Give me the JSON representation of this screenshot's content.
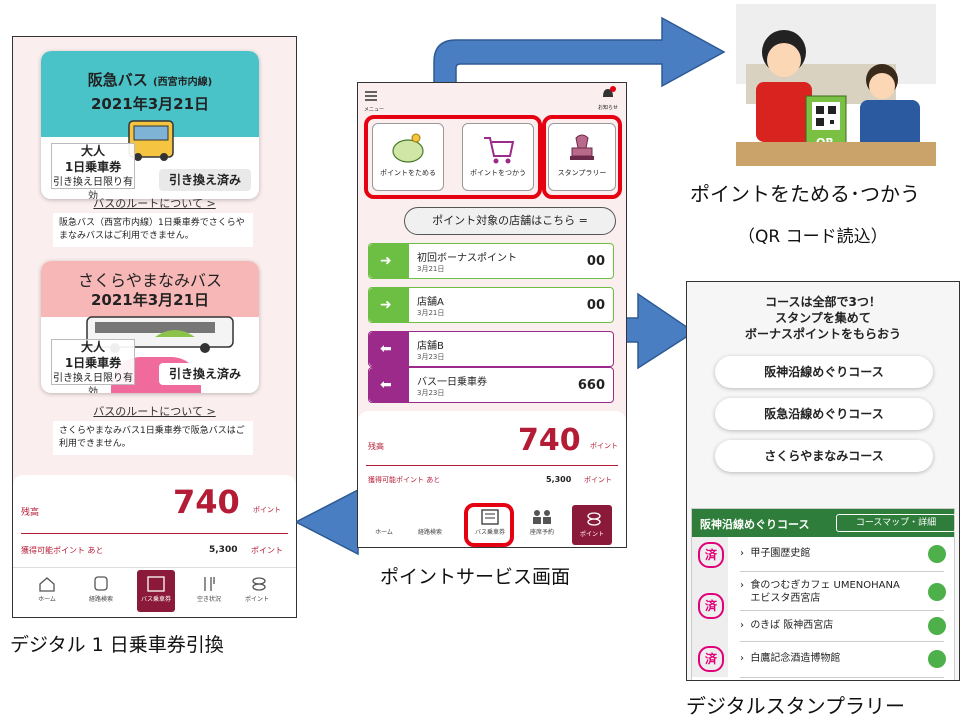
{
  "left_phone": {
    "card1": {
      "title": "阪急バス",
      "title_sub": "(西宮市内線)",
      "date": "2021年3月21日",
      "pass_line1": "大人",
      "pass_line2": "1日乗車券",
      "pass_line3": "引き換え日限り有効",
      "exchanged": "引き換え済み",
      "route_link": "バスのルートについて >",
      "note": "阪急バス（西宮市内線）1日乗車券でさくらやまなみバスはご利用できません。"
    },
    "card2": {
      "title": "さくらやまなみバス",
      "date": "2021年3月21日",
      "pass_line1": "大人",
      "pass_line2": "1日乗車券",
      "pass_line3": "引き換え日限り有効",
      "exchanged": "引き換え済み",
      "route_link": "バスのルートについて >",
      "note": "さくらやまなみバス1日乗車券で阪急バスはご利用できません。"
    },
    "balance_label": "残高",
    "balance_value": "740",
    "balance_unit": "ポイント",
    "earnable_label": "獲得可能ポイント あと",
    "earnable_value": "5,300",
    "earnable_unit": "ポイント",
    "tabs": [
      "ホーム",
      "経路検索",
      "バス乗車券",
      "空き状況",
      "ポイント"
    ]
  },
  "center_phone": {
    "menu_label": "メニュー",
    "notice_label": "お知らせ",
    "btn_collect": "ポイントをためる",
    "btn_use": "ポイントをつかう",
    "btn_stamp": "スタンプラリー",
    "store_pill": "ポイント対象の店舗はこちら",
    "rows": [
      {
        "title": "初回ボーナスポイント",
        "date": "3月21日",
        "value": "00"
      },
      {
        "title": "店舗A",
        "date": "3月21日",
        "value": "00"
      },
      {
        "title": "店舗B",
        "date": "3月23日",
        "value": ""
      },
      {
        "title": "バス一日乗車券",
        "date": "3月23日",
        "value": "660"
      }
    ],
    "balance_label": "残高",
    "balance_value": "740",
    "balance_unit": "ポイント",
    "earnable_label": "獲得可能ポイント あと",
    "earnable_value": "5,300",
    "earnable_unit": "ポイント",
    "tabs": [
      "ホーム",
      "経路検索",
      "バス乗車券",
      "座席予約",
      "ポイント"
    ]
  },
  "right_phone": {
    "heading_line1": "コースは全部で3つ！",
    "heading_line2": "スタンプを集めて",
    "heading_line3": "ボーナスポイントをもらおう",
    "courses": [
      "阪神沿線めぐりコース",
      "阪急沿線めぐりコース",
      "さくらやまなみコース"
    ],
    "course_header": "阪神沿線めぐりコース",
    "map_button": "コースマップ・詳細",
    "stamp_mark": "済",
    "spots": [
      "甲子園歴史館",
      "食のつむぎカフェ UMENOHANA エビスタ西宮店",
      "のきば 阪神西宮店",
      "白鷹記念酒造博物館"
    ]
  },
  "captions": {
    "left": "デジタル 1 日乗車券引換",
    "center": "ポイントサービス画面",
    "top_right_line1": "ポイントをためる･つかう",
    "top_right_line2": "（QR コード読込）",
    "right": "デジタルスタンプラリー"
  },
  "illustration": {
    "qr_label": "QR"
  },
  "colors": {
    "accent_red": "#e50012",
    "arrow_blue": "#4a7ec2",
    "brand_maroon": "#8b1a3a",
    "teal": "#49c3c8",
    "green": "#6cbf43",
    "purple": "#9b2a8a"
  }
}
